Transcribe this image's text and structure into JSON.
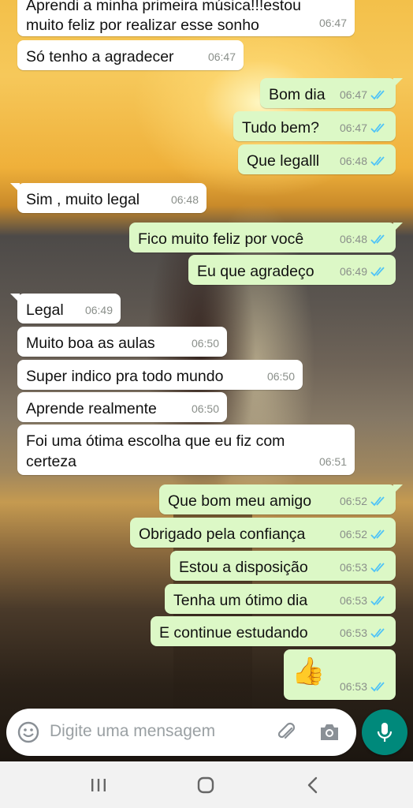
{
  "chat": {
    "messages": [
      {
        "dir": "in",
        "text": "Aprendi a minha primeira música!!!estou",
        "time": ""
      },
      {
        "dir": "in",
        "text": "muito feliz por  realizar esse sonho",
        "time": "06:47"
      },
      {
        "dir": "in",
        "text": "Só tenho a agradecer",
        "time": "06:47"
      },
      {
        "dir": "out",
        "text": "Bom dia",
        "time": "06:47"
      },
      {
        "dir": "out",
        "text": "Tudo bem?",
        "time": "06:47"
      },
      {
        "dir": "out",
        "text": "Que legalll",
        "time": "06:48"
      },
      {
        "dir": "in",
        "text": "Sim , muito legal",
        "time": "06:48"
      },
      {
        "dir": "out",
        "text": "Fico muito feliz por você",
        "time": "06:48"
      },
      {
        "dir": "out",
        "text": "Eu que agradeço",
        "time": "06:49"
      },
      {
        "dir": "in",
        "text": "Legal",
        "time": "06:49"
      },
      {
        "dir": "in",
        "text": "Muito boa as aulas",
        "time": "06:50"
      },
      {
        "dir": "in",
        "text": "Super indico pra todo mundo",
        "time": "06:50"
      },
      {
        "dir": "in",
        "text": "Aprende realmente",
        "time": "06:50"
      },
      {
        "dir": "in",
        "text": "Foi uma ótima escolha que eu fiz com",
        "time": ""
      },
      {
        "dir": "in",
        "text": "certeza",
        "time": "06:51"
      },
      {
        "dir": "out",
        "text": "Que bom meu amigo",
        "time": "06:52"
      },
      {
        "dir": "out",
        "text": "Obrigado pela confiança",
        "time": "06:52"
      },
      {
        "dir": "out",
        "text": "Estou a disposição",
        "time": "06:53"
      },
      {
        "dir": "out",
        "text": "Tenha um ótimo dia",
        "time": "06:53"
      },
      {
        "dir": "out",
        "text": "E continue estudando",
        "time": "06:53"
      },
      {
        "dir": "out",
        "text": "👍",
        "time": "06:53"
      }
    ]
  },
  "composer": {
    "placeholder": "Digite uma mensagem",
    "icons": [
      "emoji-icon",
      "attach-icon",
      "camera-icon",
      "mic-icon"
    ]
  },
  "colors": {
    "outgoing_bubble": "#dcf8c6",
    "incoming_bubble": "#ffffff",
    "read_ticks": "#4fc3f7",
    "mic_button": "#00897b"
  },
  "navbar": {
    "icons": [
      "recent-apps-icon",
      "home-icon",
      "back-icon"
    ]
  }
}
